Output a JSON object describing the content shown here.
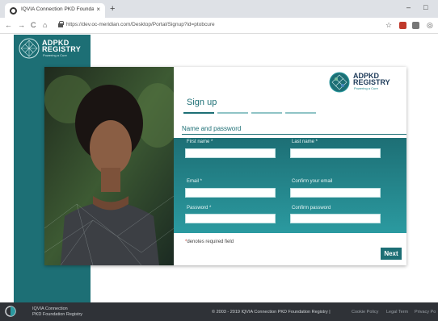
{
  "browser": {
    "tab_title": "IQVIA Connection PKD Foundatio",
    "tab_close": "×",
    "new_tab": "+",
    "url": "https://dev.oc-meridian.com/Desktop/Portal/Signup?id=ptobcure",
    "minimize": "–",
    "maximize": "□"
  },
  "sidebar": {
    "brand_line1": "ADPKD",
    "brand_line2": "REGISTRY",
    "tagline": "Powering a Cure"
  },
  "card": {
    "brand_line1": "ADPKD",
    "brand_line2": "REGISTRY",
    "tagline": "Powering a Cure",
    "title": "Sign up",
    "section": "Name and password",
    "fields": {
      "first_name": "First name *",
      "last_name": "Last name *",
      "email": "Email *",
      "confirm_email": "Confirm your email",
      "password": "Password *",
      "confirm_password": "Confirm password"
    },
    "required_note": "denotes required field",
    "required_mark": "*",
    "next_label": "Next"
  },
  "footer": {
    "name_line1": "IQVIA Connection",
    "name_line2": "PKD Foundation Registry",
    "copyright": "© 2003 - 2019 IQVIA Connection PKD Foundation Registry |",
    "link_cookie": "Cookie Policy",
    "link_legal": "Legal Term",
    "link_privacy": "Privacy Po"
  },
  "colors": {
    "brand_teal": "#1d6f75",
    "footer_bg": "#2f3237"
  }
}
